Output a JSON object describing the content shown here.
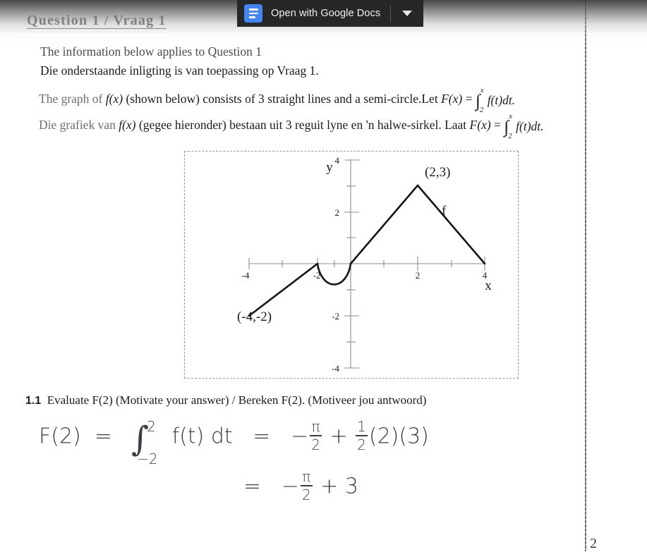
{
  "viewer": {
    "open_with_label": "Open with Google Docs",
    "docs_icon": "google-docs-icon",
    "caret_icon": "chevron-down-icon",
    "bar_bg": "#272727",
    "accent": "#4285f4"
  },
  "document": {
    "title": "Question 1 / Vraag 1",
    "line_en_1": "The information below applies to Question 1",
    "line_af_1": "Die onderstaande inligting is van toepassing op Vraag 1.",
    "line_en_2_pre": "The graph of ",
    "line_en_2_fx": "f(x)",
    "line_en_2_mid": " (shown below) consists of 3 straight lines and a semi-circle.Let ",
    "line_en_2_Fx": "F(x)",
    "line_en_2_eq": " = ",
    "line_af_2_pre": "Die grafiek van ",
    "line_af_2_fx": "f(x)",
    "line_af_2_mid": " (gegee hieronder) bestaan uit 3 reguit lyne en 'n halwe-sirkel. Laat ",
    "line_af_2_Fx": "F(x)",
    "line_af_2_eq": " = ",
    "integral_upper": "x",
    "integral_lower": "−2",
    "integral_body": "f(t)dt.",
    "question_number": "1.1",
    "question_text_en": "Evaluate F(2) (Motivate your answer) / ",
    "question_text_af": "Bereken F(2). (Motiveer jou antwoord)",
    "page_number": "2"
  },
  "handwriting": {
    "lhs": "F(2)",
    "eq1": "=",
    "int_upper": "2",
    "int_lower": "−2",
    "int_body": "f(t) dt",
    "eq2": "=",
    "rhs_sign": "−",
    "pi": "π",
    "two": "2",
    "plus": "+",
    "half_num": "1",
    "half_den": "2",
    "factors": "(2)(3)",
    "line2_eq": "=",
    "line2_sign": "−",
    "line2_pi": "π",
    "line2_den": "2",
    "line2_plus": "+ 3"
  },
  "chart_data": {
    "type": "line",
    "title": "",
    "xlabel": "x",
    "ylabel": "y",
    "xlim": [
      -4.6,
      4.6
    ],
    "ylim": [
      -4.6,
      4.6
    ],
    "xticks": [
      -4,
      -3,
      -2,
      -1,
      1,
      2,
      3,
      4
    ],
    "yticks": [
      -4,
      -2,
      2,
      4
    ],
    "xtick_labels": [
      "-4",
      "",
      "-2",
      "",
      "",
      "2",
      "",
      "4"
    ],
    "ytick_labels": [
      "-4",
      "-2",
      "2",
      "4"
    ],
    "grid": false,
    "legend": false,
    "series": [
      {
        "name": "f",
        "segments": [
          {
            "kind": "line",
            "points": [
              [
                -4,
                -2
              ],
              [
                -2,
                0
              ]
            ]
          },
          {
            "kind": "semicircle",
            "from": [
              -2,
              0
            ],
            "to": [
              0,
              0
            ],
            "radius": 1,
            "direction": "below",
            "min_y": -1
          },
          {
            "kind": "line",
            "points": [
              [
                0,
                0
              ],
              [
                2,
                3
              ]
            ]
          },
          {
            "kind": "line",
            "points": [
              [
                2,
                3
              ],
              [
                4,
                0
              ]
            ]
          }
        ]
      }
    ],
    "annotations": [
      {
        "text": "(2,3)",
        "at": [
          2,
          3
        ],
        "placement": "above-right"
      },
      {
        "text": "f",
        "at": [
          3,
          1.9
        ],
        "placement": "right"
      },
      {
        "text": "(-4,-2)",
        "at": [
          -4,
          -2
        ],
        "placement": "left-below"
      },
      {
        "text": "y",
        "at": [
          -0.5,
          3.9
        ],
        "placement": "axis-label"
      },
      {
        "text": "x",
        "at": [
          4.1,
          -0.7
        ],
        "placement": "axis-label"
      }
    ]
  }
}
